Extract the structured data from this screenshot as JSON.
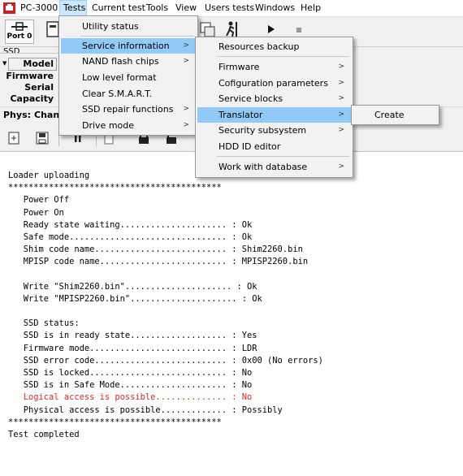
{
  "app": {
    "title": "PC-3000"
  },
  "menubar": {
    "items": [
      {
        "label": "PC-3000"
      },
      {
        "label": "Tests"
      },
      {
        "label": "Current test"
      },
      {
        "label": "Tools"
      },
      {
        "label": "View"
      },
      {
        "label": "Users tests"
      },
      {
        "label": "Windows"
      },
      {
        "label": "Help"
      }
    ]
  },
  "toolbar": {
    "port_label": "Port 0"
  },
  "ssd_panel": {
    "group_title": "SSD",
    "fields": [
      {
        "label": "Model"
      },
      {
        "label": "Firmware"
      },
      {
        "label": "Serial"
      },
      {
        "label": "Capacity"
      }
    ]
  },
  "physbar": {
    "phys_label": "Phys:",
    "channel_label": "Chann"
  },
  "menus": {
    "tests": {
      "items": [
        {
          "label": "Utility status",
          "submenu": false
        },
        {
          "label": "Service information",
          "submenu": true
        },
        {
          "label": "NAND flash chips",
          "submenu": true
        },
        {
          "label": "Low level format",
          "submenu": false
        },
        {
          "label": "Clear S.M.A.R.T.",
          "submenu": false
        },
        {
          "label": "SSD repair functions",
          "submenu": true
        },
        {
          "label": "Drive mode",
          "submenu": true
        }
      ]
    },
    "service_info": {
      "items": [
        {
          "label": "Resources backup",
          "submenu": false
        },
        {
          "label": "Firmware",
          "submenu": true
        },
        {
          "label": "Cofiguration parameters",
          "submenu": true
        },
        {
          "label": "Service blocks",
          "submenu": true
        },
        {
          "label": "Translator",
          "submenu": true
        },
        {
          "label": "Security subsystem",
          "submenu": true
        },
        {
          "label": "HDD ID editor",
          "submenu": false
        },
        {
          "label": "Work with database",
          "submenu": true
        }
      ]
    },
    "translator": {
      "items": [
        {
          "label": "Create"
        }
      ]
    }
  },
  "log": {
    "lines": [
      "Loader uploading",
      "******************************************",
      "   Power Off",
      "   Power On",
      "   Ready state waiting..................... : Ok",
      "   Safe mode............................... : Ok",
      "   Shim code name.......................... : Shim2260.bin",
      "   MPISP code name......................... : MPISP2260.bin",
      "",
      "   Write \"Shim2260.bin\"..................... : Ok",
      "   Write \"MPISP2260.bin\"..................... : Ok",
      "",
      "   SSD status:",
      "   SSD is in ready state................... : Yes",
      "   Firmware mode........................... : LDR",
      "   SSD error code.......................... : 0x00 (No errors)",
      "   SSD is locked........................... : No",
      "   SSD is in Safe Mode..................... : No",
      "   Logical access is possible.............. : No",
      "   Physical access is possible............. : Possibly",
      "******************************************",
      "Test completed"
    ],
    "red_line_index": 18
  },
  "colors": {
    "menu_highlight": "#91c9f7",
    "menubar_active": "#cce8ff",
    "log_red": "#d92b2b",
    "logo_red": "#cc1f1f"
  }
}
